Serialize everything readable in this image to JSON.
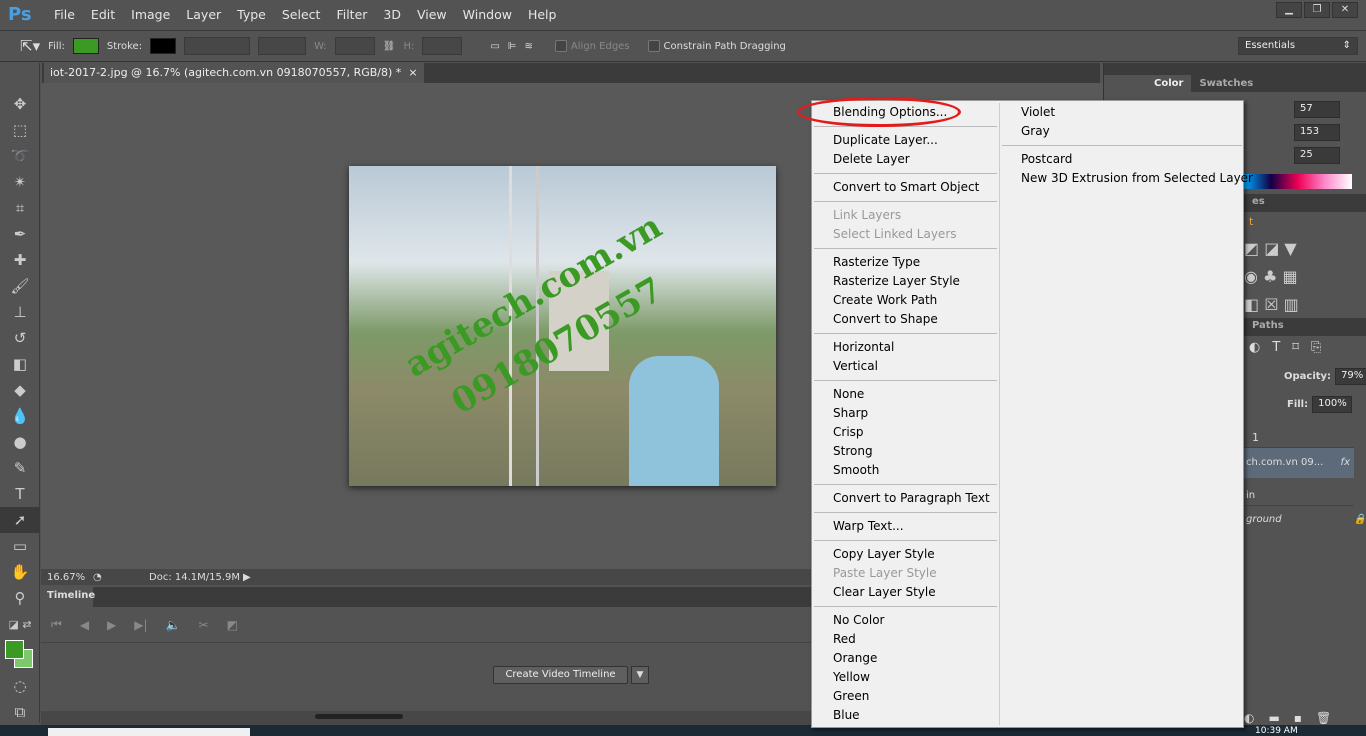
{
  "app": {
    "logo": "Ps"
  },
  "menubar": [
    "File",
    "Edit",
    "Image",
    "Layer",
    "Type",
    "Select",
    "Filter",
    "3D",
    "View",
    "Window",
    "Help"
  ],
  "options": {
    "fill_label": "Fill:",
    "fill_color": "#3a9a24",
    "stroke_label": "Stroke:",
    "stroke_color": "#000000",
    "w_label": "W:",
    "h_label": "H:",
    "align_edges": "Align Edges",
    "constrain": "Constrain Path Dragging",
    "workspace": "Essentials"
  },
  "document": {
    "tab_title": "iot-2017-2.jpg @ 16.7% (agitech.com.vn   0918070557, RGB/8) *",
    "close": "×",
    "watermark_1": "agitech.com.vn",
    "watermark_2": "0918070557"
  },
  "status": {
    "zoom": "16.67%",
    "doc": "Doc: 14.1M/15.9M"
  },
  "timeline": {
    "tab": "Timeline",
    "create_button": "Create Video Timeline"
  },
  "colors": {
    "foreground": "#3a9a24",
    "background": "#7cc96b"
  },
  "color_panel": {
    "tabs": [
      "Color",
      "Swatches"
    ],
    "r": "57",
    "g": "153",
    "b": "25"
  },
  "adjustments": {
    "tab_fragment": "es",
    "label_fragment": "t"
  },
  "layers": {
    "tab": "Paths",
    "opacity_label": "Opacity:",
    "opacity": "79%",
    "fill_label": "Fill:",
    "fill": "100%",
    "rows": [
      "1",
      "ch.com.vn   09...",
      "in",
      "ground"
    ],
    "fx": "fx"
  },
  "context_menu": {
    "left_groups": [
      [
        {
          "label": "Blending Options...",
          "disabled": false
        }
      ],
      [
        {
          "label": "Duplicate Layer...",
          "disabled": false
        },
        {
          "label": "Delete Layer",
          "disabled": false
        }
      ],
      [
        {
          "label": "Convert to Smart Object",
          "disabled": false
        }
      ],
      [
        {
          "label": "Link Layers",
          "disabled": true
        },
        {
          "label": "Select Linked Layers",
          "disabled": true
        }
      ],
      [
        {
          "label": "Rasterize Type",
          "disabled": false
        },
        {
          "label": "Rasterize Layer Style",
          "disabled": false
        },
        {
          "label": "Create Work Path",
          "disabled": false
        },
        {
          "label": "Convert to Shape",
          "disabled": false
        }
      ],
      [
        {
          "label": "Horizontal",
          "disabled": false
        },
        {
          "label": "Vertical",
          "disabled": false
        }
      ],
      [
        {
          "label": "None",
          "disabled": false
        },
        {
          "label": "Sharp",
          "disabled": false
        },
        {
          "label": "Crisp",
          "disabled": false
        },
        {
          "label": "Strong",
          "disabled": false
        },
        {
          "label": "Smooth",
          "disabled": false
        }
      ],
      [
        {
          "label": "Convert to Paragraph Text",
          "disabled": false
        }
      ],
      [
        {
          "label": "Warp Text...",
          "disabled": false
        }
      ],
      [
        {
          "label": "Copy Layer Style",
          "disabled": false
        },
        {
          "label": "Paste Layer Style",
          "disabled": true
        },
        {
          "label": "Clear Layer Style",
          "disabled": false
        }
      ],
      [
        {
          "label": "No Color",
          "disabled": false
        },
        {
          "label": "Red",
          "disabled": false
        },
        {
          "label": "Orange",
          "disabled": false
        },
        {
          "label": "Yellow",
          "disabled": false
        },
        {
          "label": "Green",
          "disabled": false
        },
        {
          "label": "Blue",
          "disabled": false
        }
      ]
    ],
    "right_groups": [
      [
        {
          "label": "Violet",
          "disabled": false
        },
        {
          "label": "Gray",
          "disabled": false
        }
      ],
      [
        {
          "label": "Postcard",
          "disabled": false
        },
        {
          "label": "New 3D Extrusion from Selected Layer",
          "disabled": false
        }
      ]
    ],
    "highlight_color": "#e41b1b"
  },
  "taskbar": {
    "clock": "10:39 AM"
  }
}
